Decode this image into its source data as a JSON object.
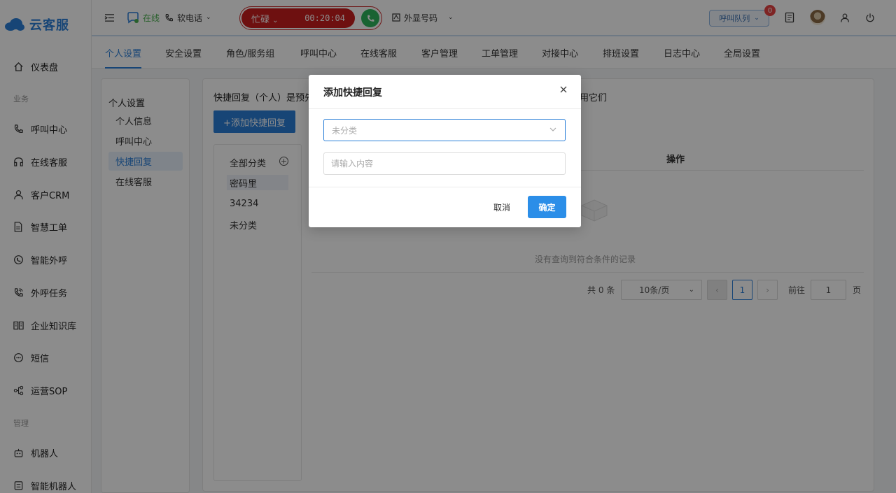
{
  "app": {
    "name": "云客服"
  },
  "sidebar": {
    "groups": {
      "business": "业务",
      "admin": "管理"
    },
    "items": [
      {
        "label": "仪表盘",
        "icon": "home-icon"
      },
      {
        "label": "呼叫中心",
        "icon": "phone-icon"
      },
      {
        "label": "在线客服",
        "icon": "headset-icon"
      },
      {
        "label": "客户CRM",
        "icon": "user-icon"
      },
      {
        "label": "智慧工单",
        "icon": "document-icon"
      },
      {
        "label": "智能外呼",
        "icon": "whatsapp-phone-icon"
      },
      {
        "label": "外呼任务",
        "icon": "outbound-call-icon"
      },
      {
        "label": "企业知识库",
        "icon": "book-icon"
      },
      {
        "label": "短信",
        "icon": "sms-icon"
      },
      {
        "label": "运营SOP",
        "icon": "flow-icon"
      },
      {
        "label": "机器人",
        "icon": "robot-icon"
      },
      {
        "label": "智能机器人",
        "icon": "smart-robot-icon"
      }
    ]
  },
  "topbar": {
    "status": "在线",
    "softphone": "软电话",
    "busy_label": "忙碌",
    "timer": "00:20:04",
    "outbound_number": "外显号码",
    "queue_label": "呼叫队列",
    "queue_badge": "0"
  },
  "tabs": [
    "个人设置",
    "安全设置",
    "角色/服务组",
    "呼叫中心",
    "在线客服",
    "客户管理",
    "工单管理",
    "对接中心",
    "排班设置",
    "日志中心",
    "全局设置"
  ],
  "subnav": {
    "title": "个人设置",
    "items": [
      "个人信息",
      "呼叫中心",
      "快捷回复",
      "在线客服"
    ]
  },
  "main": {
    "description_start": "快捷回复（个人）是预先",
    "description_end": "用它们",
    "add_button": "+添加快捷回复",
    "categories": [
      "全部分类",
      "密码里",
      "34234",
      "未分类"
    ],
    "table_header_ops": "操作",
    "empty_text": "没有查询到符合条件的记录"
  },
  "pagination": {
    "total_prefix": "共",
    "total": "0",
    "total_suffix": "条",
    "page_size": "10条/页",
    "current_page": "1",
    "goto_label": "前往",
    "goto_value": "1",
    "page_unit": "页"
  },
  "modal": {
    "title": "添加快捷回复",
    "category_placeholder": "未分类",
    "content_placeholder": "请输入内容",
    "cancel": "取消",
    "confirm": "确定"
  },
  "colors": {
    "accent": "#2b7fd8",
    "busy": "#c81e1e",
    "call": "#2fb55b",
    "badge": "#e64343"
  }
}
